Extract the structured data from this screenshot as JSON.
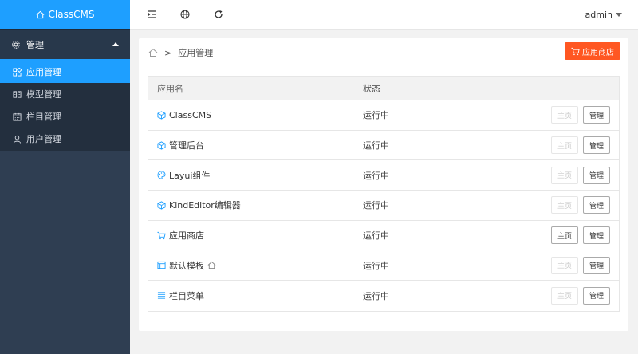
{
  "app": {
    "title": "ClassCMS"
  },
  "sidebar": {
    "group_label": "管理",
    "items": [
      {
        "label": "应用管理",
        "icon": "app-grid-icon",
        "active": true
      },
      {
        "label": "模型管理",
        "icon": "book-icon",
        "active": false
      },
      {
        "label": "栏目管理",
        "icon": "calendar-icon",
        "active": false
      },
      {
        "label": "用户管理",
        "icon": "user-icon",
        "active": false
      }
    ]
  },
  "topbar": {
    "icons": [
      "indent-icon",
      "globe-icon",
      "refresh-icon"
    ],
    "user": "admin"
  },
  "breadcrumb": {
    "separator": ">",
    "current": "应用管理"
  },
  "store_button": {
    "label": "应用商店"
  },
  "table": {
    "headers": [
      "应用名",
      "状态"
    ],
    "rows": [
      {
        "name": "ClassCMS",
        "icon": "cube-icon",
        "status": "运行中",
        "home": "主页",
        "home_enabled": false,
        "manage": "管理"
      },
      {
        "name": "管理后台",
        "icon": "cube-icon",
        "status": "运行中",
        "home": "主页",
        "home_enabled": false,
        "manage": "管理"
      },
      {
        "name": "Layui组件",
        "icon": "palette-icon",
        "status": "运行中",
        "home": "主页",
        "home_enabled": false,
        "manage": "管理"
      },
      {
        "name": "KindEditor编辑器",
        "icon": "cube-icon",
        "status": "运行中",
        "home": "主页",
        "home_enabled": false,
        "manage": "管理"
      },
      {
        "name": "应用商店",
        "icon": "cart-icon",
        "status": "运行中",
        "home": "主页",
        "home_enabled": true,
        "manage": "管理"
      },
      {
        "name": "默认模板",
        "icon": "template-icon",
        "status": "运行中",
        "home": "主页",
        "home_enabled": false,
        "manage": "管理",
        "badge_icon": "home-icon"
      },
      {
        "name": "栏目菜单",
        "icon": "list-icon",
        "status": "运行中",
        "home": "主页",
        "home_enabled": false,
        "manage": "管理"
      }
    ]
  }
}
